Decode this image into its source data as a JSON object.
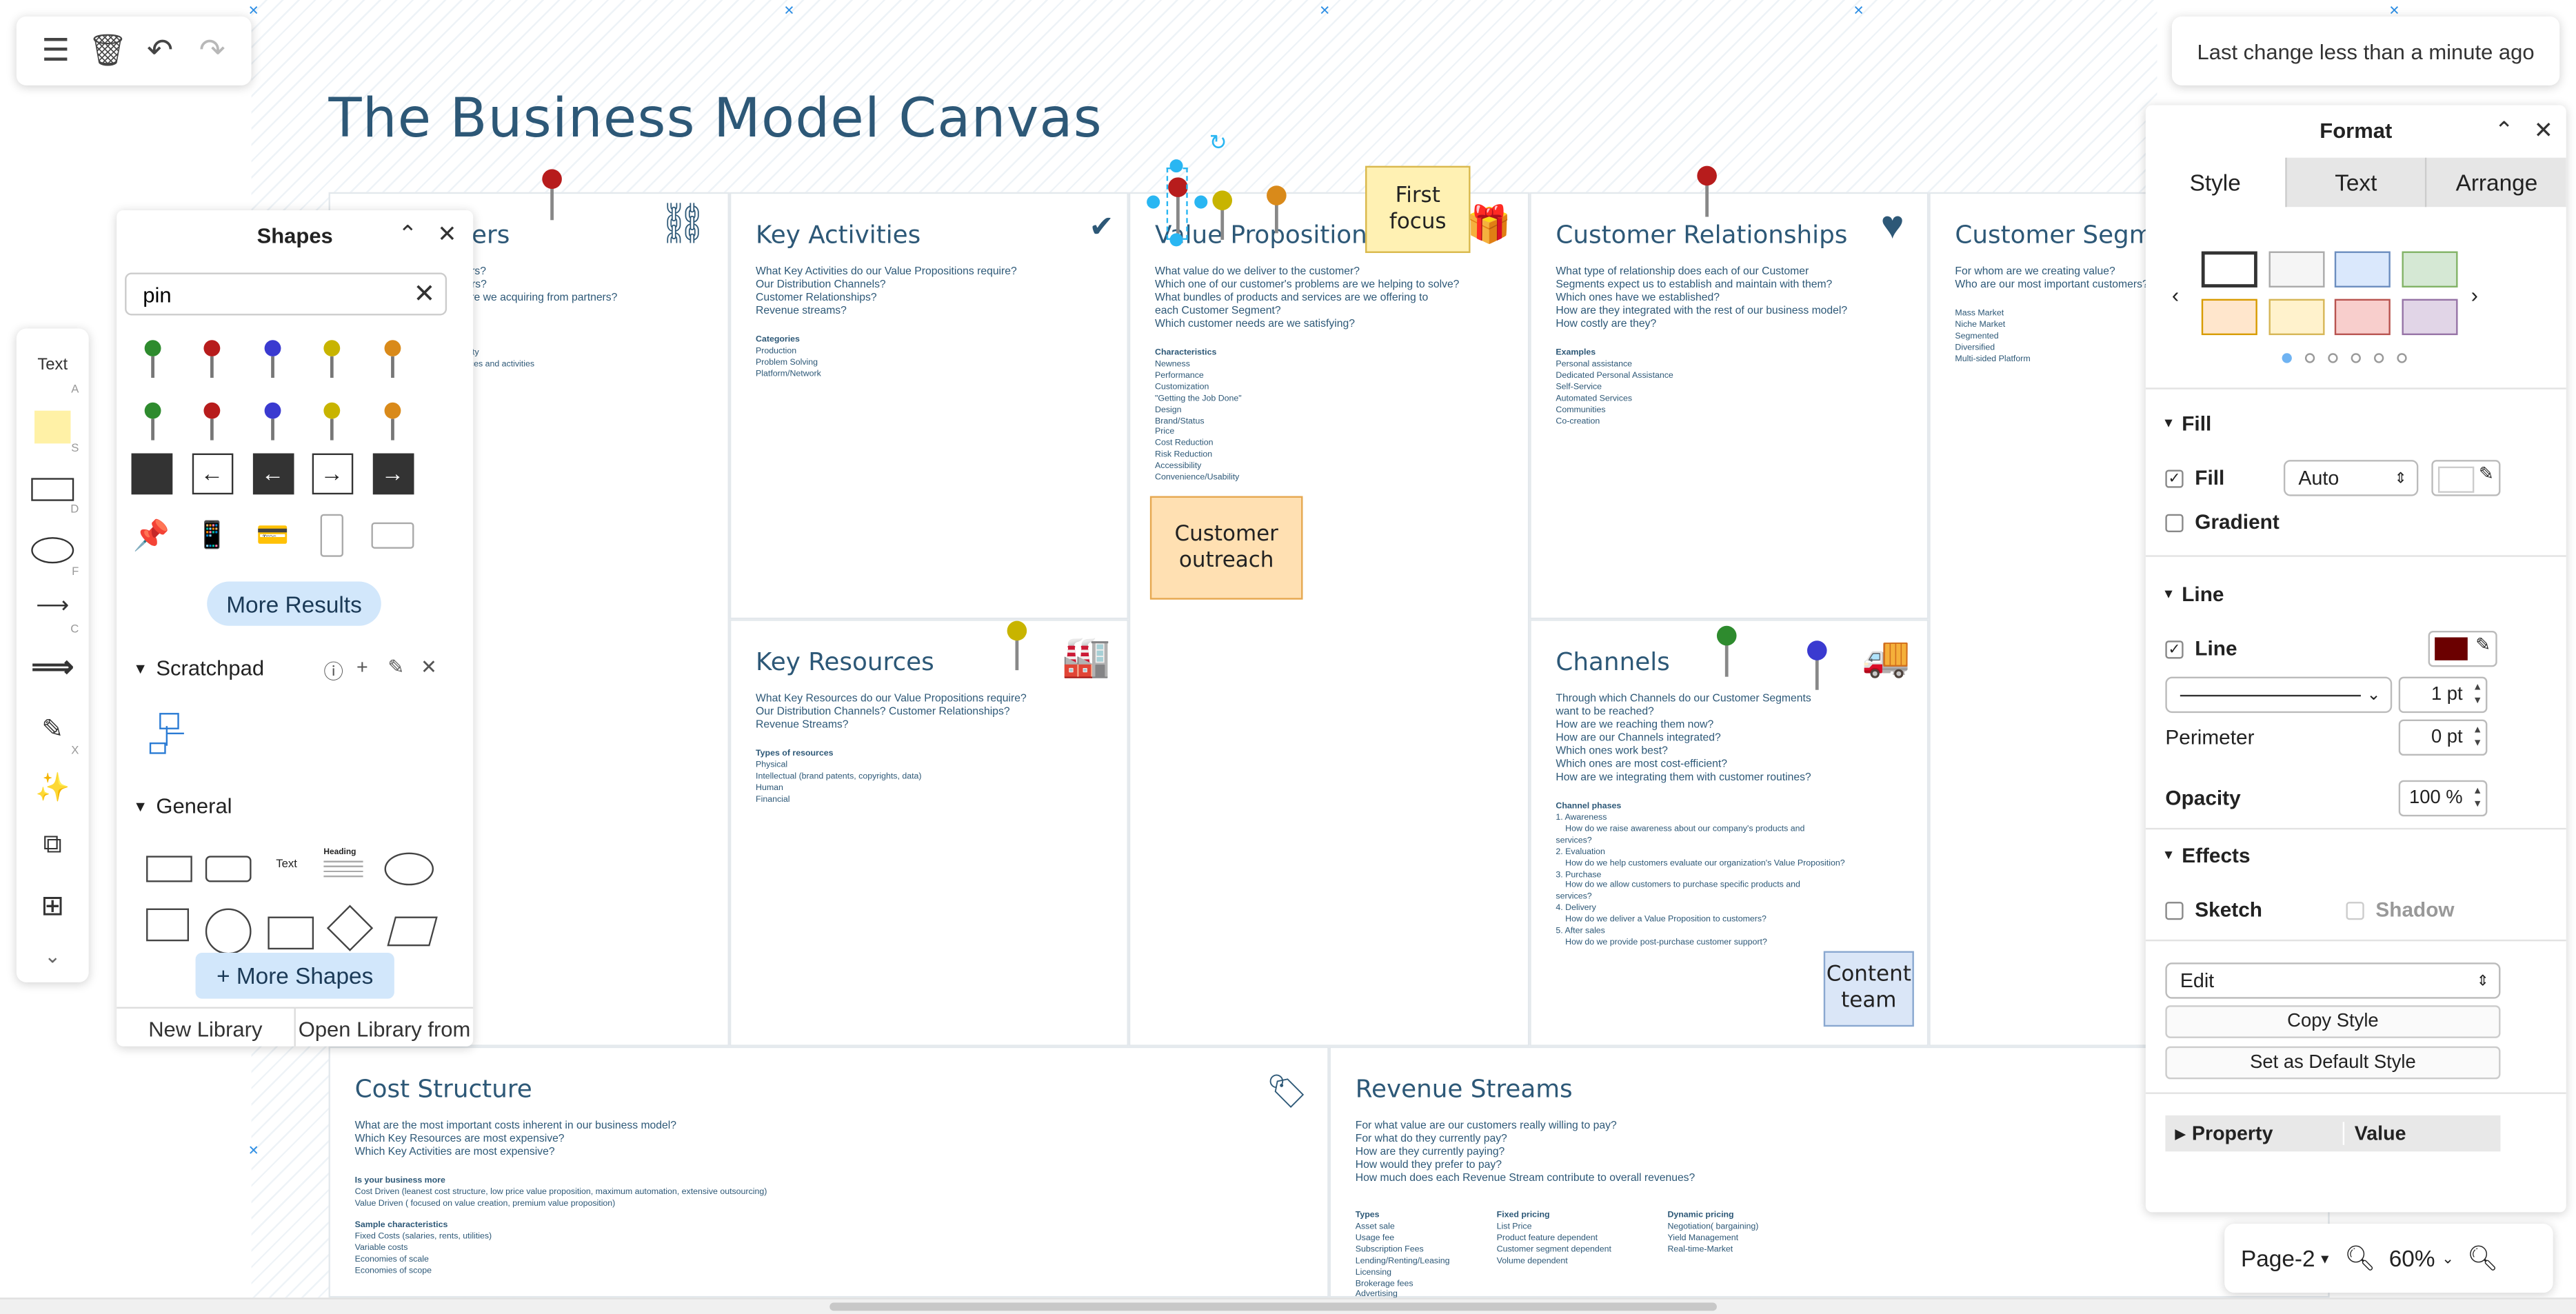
{
  "canvas_title": "The Business Model Canvas",
  "colors": {
    "accent": "#2d5877",
    "selection": "#29b6f2",
    "pin_red": "#b71c1c",
    "pin_yellow": "#c8b400",
    "pin_orange": "#d98a1a",
    "pin_green": "#2e8b2e",
    "pin_blue": "#3a3ad0"
  },
  "toolbar": {
    "menu_icon": "hamburger-icon",
    "delete_icon": "trash-icon",
    "undo_icon": "undo-icon",
    "redo_icon": "redo-icon"
  },
  "status": "Last change less than a minute ago",
  "left_tools": [
    {
      "name": "text-tool",
      "label": "Text",
      "key": "A"
    },
    {
      "name": "note-tool",
      "label": "",
      "key": "S"
    },
    {
      "name": "rectangle-tool",
      "label": "",
      "key": "D"
    },
    {
      "name": "ellipse-tool",
      "label": "",
      "key": "F"
    },
    {
      "name": "line-tool",
      "label": "",
      "key": "C"
    },
    {
      "name": "arrow-tool",
      "label": "",
      "key": ""
    },
    {
      "name": "freehand-tool",
      "label": "",
      "key": "X"
    },
    {
      "name": "ai-generate-tool",
      "label": "",
      "key": ""
    },
    {
      "name": "shapes-tool",
      "label": "",
      "key": ""
    },
    {
      "name": "insert-tool",
      "label": "",
      "key": ""
    },
    {
      "name": "more-tools",
      "label": "",
      "key": ""
    }
  ],
  "cells": {
    "key_partners": {
      "title": "Key Partners",
      "questions": "Who are our Key Partners?\nWho are our key suppliers?\nWhich Key Resources are we acquiring from partners?",
      "details": "Motivations for partnerships\nOptimization and economy\nReduction of risk and uncertainty\nAcquisition of particular resources and activities"
    },
    "key_activities": {
      "title": "Key Activities",
      "questions": "What Key Activities do our Value Propositions require?\nOur Distribution Channels?\nCustomer Relationships?\nRevenue streams?",
      "details_head": "Categories",
      "details": "Production\nProblem Solving\nPlatform/Network"
    },
    "value_propositions": {
      "title": "Value Propositions",
      "questions": "What value do we deliver to the customer?\nWhich one of our customer's problems are we helping to solve?\nWhat bundles of products and services are we offering to\neach Customer Segment?\nWhich customer needs are we satisfying?",
      "details_head": "Characteristics",
      "details": "Newness\nPerformance\nCustomization\n\"Getting the Job Done\"\nDesign\nBrand/Status\nPrice\nCost Reduction\nRisk Reduction\nAccessibility\nConvenience/Usability"
    },
    "customer_relationships": {
      "title": "Customer Relationships",
      "questions": "What type of relationship does each of our Customer\nSegments expect us to establish and maintain with them?\nWhich ones have we established?\nHow are they integrated with the rest of our business model?\nHow costly are they?",
      "details_head": "Examples",
      "details": "Personal assistance\nDedicated Personal Assistance\nSelf-Service\nAutomated Services\nCommunities\nCo-creation"
    },
    "customer_segments": {
      "title": "Customer Segments",
      "questions": "For whom are we creating value?\nWho are our most important customers?",
      "details": "Mass Market\nNiche Market\nSegmented\nDiversified\nMulti-sided Platform"
    },
    "key_resources": {
      "title": "Key Resources",
      "questions": "What Key Resources do our Value Propositions require?\nOur Distribution Channels? Customer Relationships?\nRevenue Streams?",
      "details_head": "Types of resources",
      "details": "Physical\nIntellectual (brand patents, copyrights, data)\nHuman\nFinancial"
    },
    "channels": {
      "title": "Channels",
      "questions": "Through which Channels do our Customer Segments\nwant to be reached?\nHow are we reaching them now?\nHow are our Channels integrated?\nWhich ones work best?\nWhich ones are most cost-efficient?\nHow are we integrating them with customer routines?",
      "details_head": "Channel phases",
      "details": "1. Awareness\n    How do we raise awareness about our company's products and\nservices?\n2. Evaluation\n    How do we help customers evaluate our organization's Value Proposition?\n3. Purchase\n    How do we allow customers to purchase specific products and\nservices?\n4. Delivery\n    How do we deliver a Value Proposition to customers?\n5. After sales\n    How do we provide post-purchase customer support?"
    },
    "cost_structure": {
      "title": "Cost Structure",
      "questions": "What are the most important costs inherent in our business model?\nWhich Key Resources are most expensive?\nWhich Key Activities are most expensive?",
      "details_head": "Is your business more",
      "details": "Cost Driven (leanest cost structure, low price value proposition, maximum automation, extensive outsourcing)\nValue Driven ( focused on value creation, premium value proposition)",
      "details2_head": "Sample characteristics",
      "details2": "Fixed Costs (salaries, rents, utilities)\nVariable costs\nEconomies of scale\nEconomies of scope"
    },
    "revenue_streams": {
      "title": "Revenue Streams",
      "questions": "For what value are our customers really willing to pay?\nFor what do they currently pay?\nHow are they currently paying?\nHow would they prefer to pay?\nHow much does each Revenue Stream contribute to overall revenues?",
      "col1_head": "Types",
      "col1": "Asset sale\nUsage fee\nSubscription Fees\nLending/Renting/Leasing\nLicensing\nBrokerage fees\nAdvertising",
      "col2_head": "Fixed pricing",
      "col2": "List Price\nProduct feature dependent\nCustomer segment dependent\nVolume dependent",
      "col3_head": "Dynamic pricing",
      "col3": "Negotiation( bargaining)\nYield Management\nReal-time-Market"
    }
  },
  "stickies": {
    "first_focus": "First\nfocus",
    "customer_outreach": "Customer\noutreach",
    "content_team": "Content\nteam"
  },
  "shapes_panel": {
    "title": "Shapes",
    "search_value": "pin",
    "more_results": "More Results",
    "scratchpad": "Scratchpad",
    "general": "General",
    "more_shapes": "+ More Shapes",
    "new_library": "New Library",
    "open_library": "Open Library from",
    "text_shape": "Text",
    "heading_shape": "Heading"
  },
  "format_panel": {
    "title": "Format",
    "tabs": [
      "Style",
      "Text",
      "Arrange"
    ],
    "swatches": [
      "#ffffff",
      "#f5f5f5",
      "#dae8fc",
      "#d5e8d4",
      "#ffe6cc",
      "#fff2cc",
      "#f8cecc",
      "#e1d5e7"
    ],
    "fill_section": "Fill",
    "fill_label": "Fill",
    "fill_value": "Auto",
    "gradient_label": "Gradient",
    "line_section": "Line",
    "line_label": "Line",
    "line_color": "#6b0000",
    "line_width": "1 pt",
    "perimeter_label": "Perimeter",
    "perimeter_value": "0 pt",
    "opacity_label": "Opacity",
    "opacity_value": "100 %",
    "effects_section": "Effects",
    "sketch_label": "Sketch",
    "shadow_label": "Shadow",
    "edit_select": "Edit",
    "copy_style": "Copy Style",
    "set_default": "Set as Default Style",
    "property_col": "Property",
    "value_col": "Value"
  },
  "page_bar": {
    "page": "Page-2",
    "zoom": "60%"
  }
}
